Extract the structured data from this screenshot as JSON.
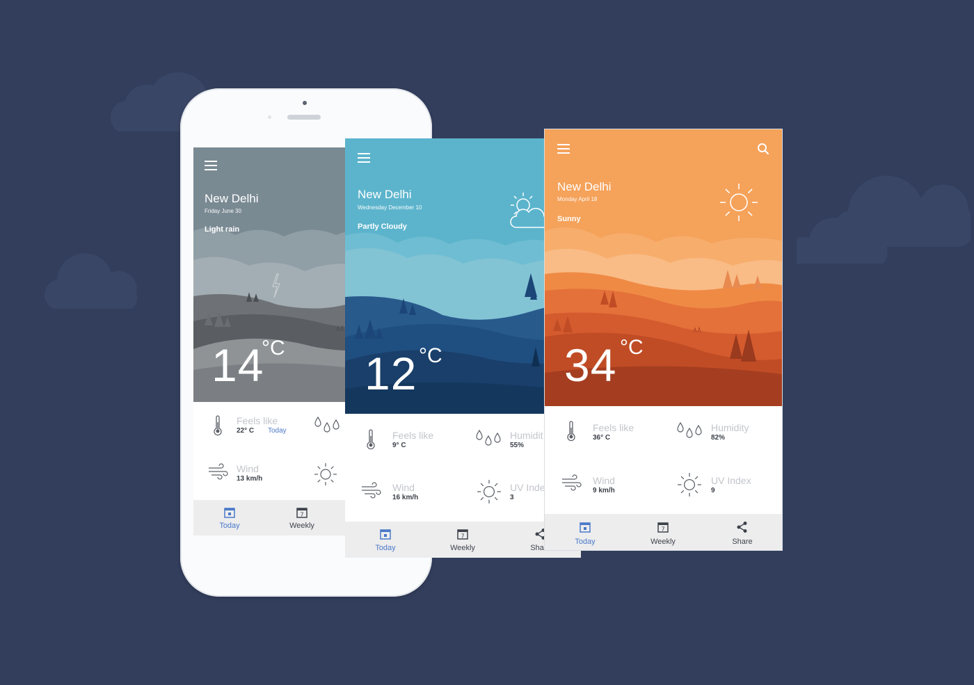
{
  "screens": [
    {
      "id": "rainy",
      "menu_icon": "hamburger-icon",
      "city": "New Delhi",
      "date": "Friday June 30",
      "condition": "Light rain",
      "temperature": "14",
      "unit": "°C",
      "stats": {
        "feels_like_label": "Feels like",
        "feels_like_value": "22° C",
        "today_link": "Today",
        "wind_label": "Wind",
        "wind_value": "13 km/h"
      },
      "tabs": [
        {
          "label": "Today",
          "icon": "calendar-today-icon",
          "active": true
        },
        {
          "label": "Weekly",
          "icon": "calendar-week-icon",
          "active": false
        }
      ],
      "colors": {
        "sky": "#7a8a93",
        "accent": "#4a79c8"
      }
    },
    {
      "id": "partly-cloudy",
      "menu_icon": "hamburger-icon",
      "city": "New Delhi",
      "date": "Wednesday December 10",
      "condition": "Partly Cloudy",
      "condition_icon": "partly-cloudy-icon",
      "temperature": "12",
      "unit": "°C",
      "stats": {
        "feels_like_label": "Feels like",
        "feels_like_value": "9° C",
        "humidity_label": "Humidit",
        "humidity_value": "55%",
        "wind_label": "Wind",
        "wind_value": "16 km/h",
        "uv_label": "UV Inde",
        "uv_value": "3"
      },
      "tabs": [
        {
          "label": "Today",
          "icon": "calendar-today-icon",
          "active": true
        },
        {
          "label": "Weekly",
          "icon": "calendar-week-icon",
          "active": false
        },
        {
          "label": "Share",
          "icon": "share-icon",
          "active": false
        }
      ],
      "colors": {
        "sky": "#5cb4cc",
        "accent": "#4a79c8"
      }
    },
    {
      "id": "sunny",
      "menu_icon": "hamburger-icon",
      "search_icon": "search-icon",
      "city": "New Delhi",
      "date": "Monday April 18",
      "condition": "Sunny",
      "condition_icon": "sun-icon",
      "temperature": "34",
      "unit": "°C",
      "stats": {
        "feels_like_label": "Feels like",
        "feels_like_value": "36° C",
        "humidity_label": "Humidity",
        "humidity_value": "82%",
        "wind_label": "Wind",
        "wind_value": "9 km/h",
        "uv_label": "UV Index",
        "uv_value": "9"
      },
      "tabs": [
        {
          "label": "Today",
          "icon": "calendar-today-icon",
          "active": true
        },
        {
          "label": "Weekly",
          "icon": "calendar-week-icon",
          "active": false
        },
        {
          "label": "Share",
          "icon": "share-icon",
          "active": false
        }
      ],
      "colors": {
        "sky": "#f5a25a",
        "accent": "#4a79c8"
      }
    }
  ]
}
